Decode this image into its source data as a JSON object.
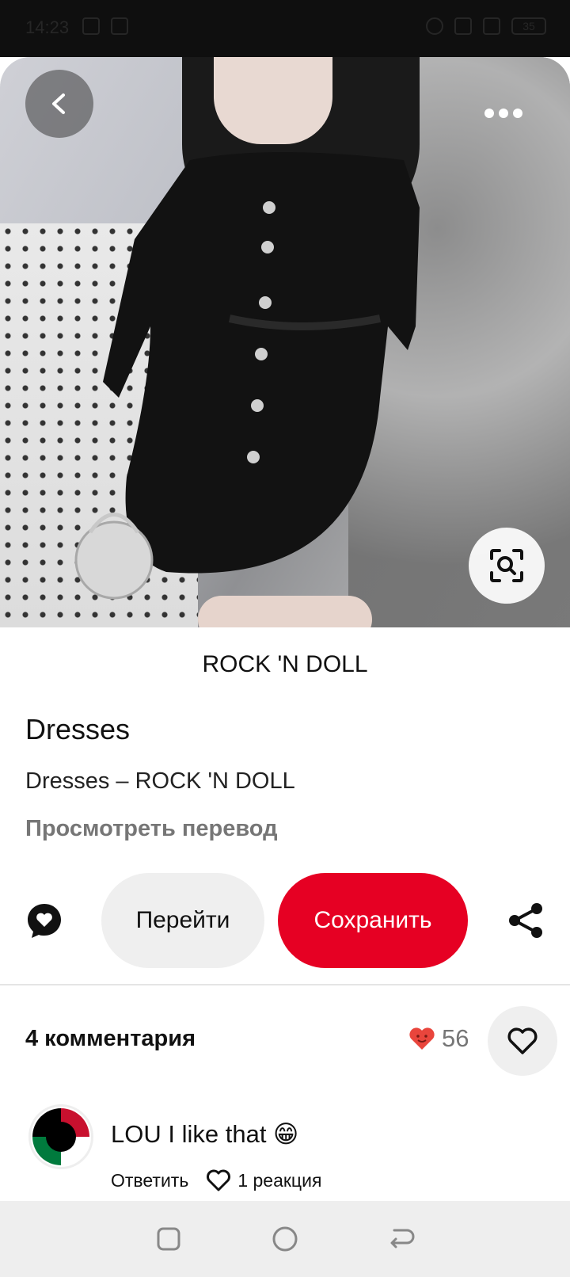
{
  "status_bar": {
    "time": "14:23",
    "battery": "35"
  },
  "pin": {
    "brand": "ROCK 'N DOLL",
    "title": "Dresses",
    "description": "Dresses – ROCK 'N DOLL",
    "translate_label": "Просмотреть перевод"
  },
  "actions": {
    "go_label": "Перейти",
    "save_label": "Сохранить"
  },
  "comments": {
    "header": "4 комментария",
    "reaction_count": "56",
    "items": [
      {
        "author": "LOU",
        "text": "I like that 😁",
        "reply_label": "Ответить",
        "reaction_label": "1 реакция"
      }
    ]
  },
  "colors": {
    "save_red": "#e60023",
    "pill_gray": "#efefef",
    "muted_text": "#767676"
  },
  "icons": {
    "back": "chevron-left-icon",
    "more": "more-dots-icon",
    "lens": "visual-search-icon",
    "comment": "comment-bubble-heart-icon",
    "share": "share-icon",
    "heart": "heart-outline-icon"
  }
}
